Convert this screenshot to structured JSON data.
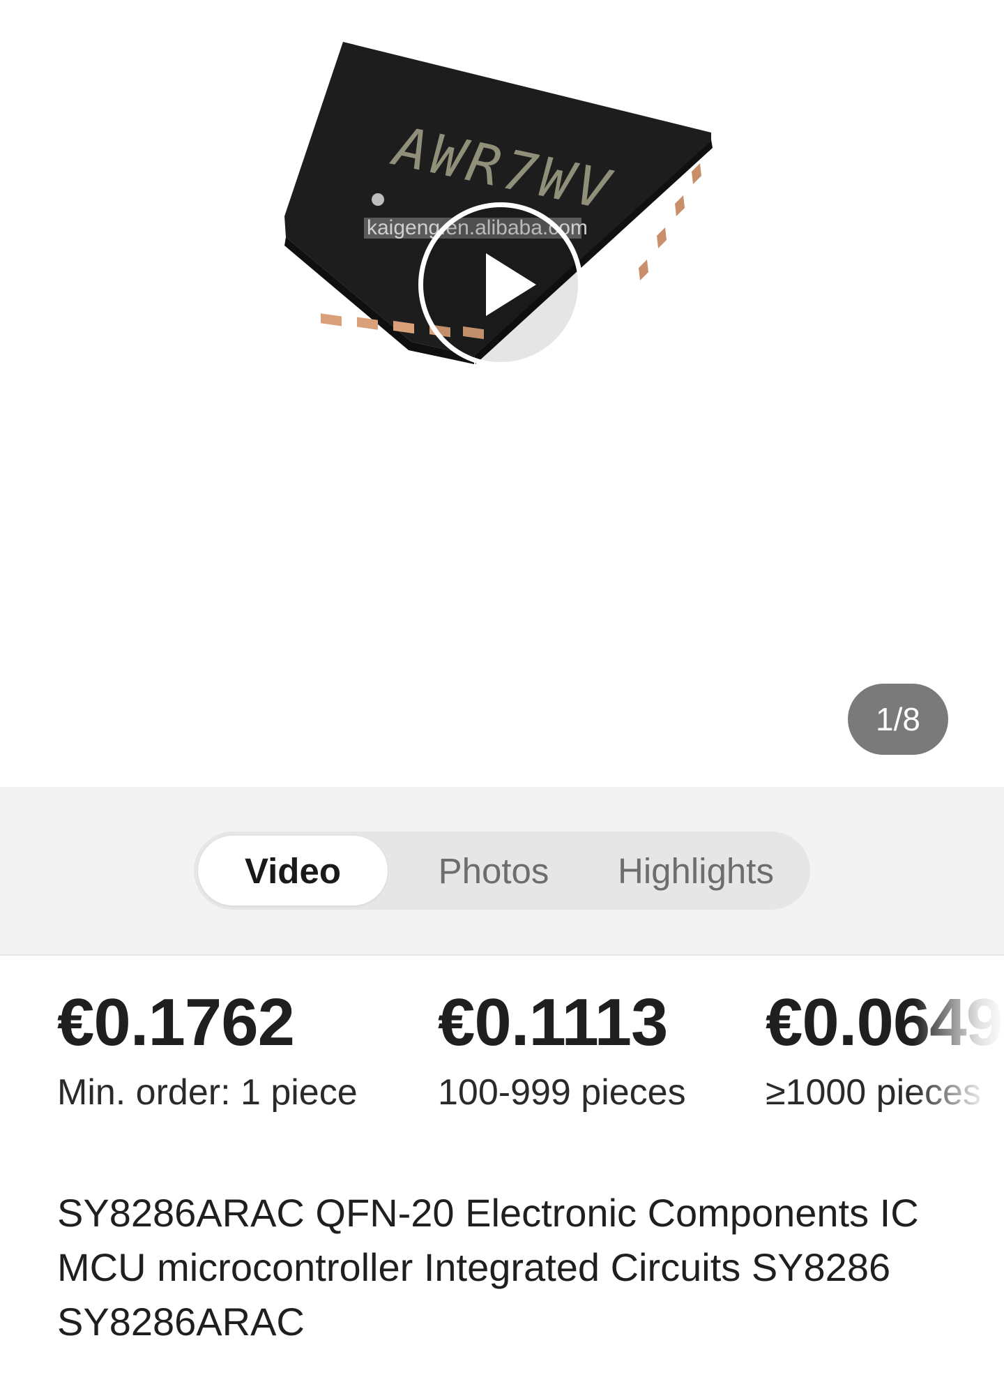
{
  "gallery": {
    "chip_marking": "AWR7WV",
    "watermark": "kaigeng.en.alibaba.com",
    "counter": "1/8"
  },
  "tabs": [
    {
      "label": "Video",
      "active": true
    },
    {
      "label": "Photos",
      "active": false
    },
    {
      "label": "Highlights",
      "active": false
    }
  ],
  "prices": [
    {
      "amount": "€0.1762",
      "quantity": "Min. order: 1 piece"
    },
    {
      "amount": "€0.1113",
      "quantity": "100-999 pieces"
    },
    {
      "amount": "€0.0649",
      "quantity": "≥1000 pieces"
    }
  ],
  "product": {
    "title": "SY8286ARAC QFN-20 Electronic Components IC MCU microcontroller Integrated Circuits SY8286 SY8286ARAC"
  },
  "colors": {
    "tab_band_bg": "#f3f3f3",
    "badge_bg": "#7a7a7a",
    "chip_body": "#1c1c1c",
    "chip_pad": "#d9a07a"
  }
}
